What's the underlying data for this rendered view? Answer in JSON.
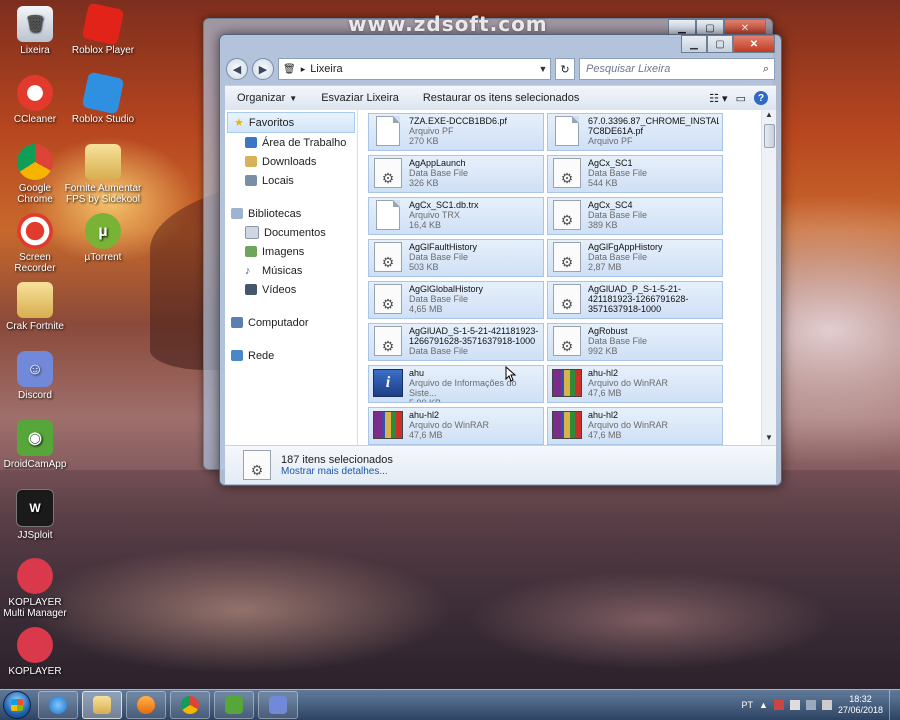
{
  "watermark": "www.zdsoft.com",
  "desktop_icons": [
    {
      "label": "Lixeira"
    },
    {
      "label": "Roblox Player"
    },
    {
      "label": "CCleaner"
    },
    {
      "label": "Roblox Studio"
    },
    {
      "label": "Google Chrome"
    },
    {
      "label": "Fornite Aumentar FPS by Sidekool"
    },
    {
      "label": "Screen Recorder"
    },
    {
      "label": "µTorrent"
    },
    {
      "label": "Crak Fortnite"
    },
    {
      "label": "Discord"
    },
    {
      "label": "DroidCamApp"
    },
    {
      "label": "JJSploit"
    },
    {
      "label": "KOPLAYER Multi Manager"
    },
    {
      "label": "KOPLAYER"
    }
  ],
  "window": {
    "minimize": "▁",
    "maximize": "▢",
    "close": "✕",
    "address": {
      "path": "Lixeira"
    },
    "search": {
      "placeholder": "Pesquisar Lixeira"
    },
    "toolbar": {
      "organize": "Organizar",
      "empty": "Esvaziar Lixeira",
      "restore": "Restaurar os itens selecionados"
    },
    "sidebar": {
      "favorites": "Favoritos",
      "desktop": "Área de Trabalho",
      "downloads": "Downloads",
      "places": "Locais",
      "libraries": "Bibliotecas",
      "documents": "Documentos",
      "images": "Imagens",
      "music": "Músicas",
      "videos": "Vídeos",
      "computer": "Computador",
      "network": "Rede"
    },
    "files": [
      {
        "name": "7ZA.EXE-DCCB1BD6.pf",
        "type": "Arquivo PF",
        "size": "270 KB",
        "icon": "doc"
      },
      {
        "name": "67.0.3396.87_CHROME_INSTALLER-7C8DE61A.pf",
        "type": "Arquivo PF",
        "size": "",
        "icon": "doc"
      },
      {
        "name": "AgAppLaunch",
        "type": "Data Base File",
        "size": "326 KB",
        "icon": "gear"
      },
      {
        "name": "AgCx_SC1",
        "type": "Data Base File",
        "size": "544 KB",
        "icon": "gear"
      },
      {
        "name": "AgCx_SC1.db.trx",
        "type": "Arquivo TRX",
        "size": "16,4 KB",
        "icon": "doc"
      },
      {
        "name": "AgCx_SC4",
        "type": "Data Base File",
        "size": "389 KB",
        "icon": "gear"
      },
      {
        "name": "AgGlFaultHistory",
        "type": "Data Base File",
        "size": "503 KB",
        "icon": "gear"
      },
      {
        "name": "AgGlFgAppHistory",
        "type": "Data Base File",
        "size": "2,87 MB",
        "icon": "gear"
      },
      {
        "name": "AgGlGlobalHistory",
        "type": "Data Base File",
        "size": "4,65 MB",
        "icon": "gear"
      },
      {
        "name": "AgGlUAD_P_S-1-5-21-421181923-1266791628-3571637918-1000",
        "type": "",
        "size": "",
        "icon": "gear"
      },
      {
        "name": "AgGlUAD_S-1-5-21-421181923-1266791628-3571637918-1000",
        "type": "Data Base File",
        "size": "",
        "icon": "gear"
      },
      {
        "name": "AgRobust",
        "type": "Data Base File",
        "size": "992 KB",
        "icon": "gear"
      },
      {
        "name": "ahu",
        "type": "Arquivo de Informações do Siste...",
        "size": "5,90 KB",
        "icon": "info"
      },
      {
        "name": "ahu-hl2",
        "type": "Arquivo do WinRAR",
        "size": "47,6 MB",
        "icon": "rar"
      },
      {
        "name": "ahu-hl2",
        "type": "Arquivo do WinRAR",
        "size": "47,6 MB",
        "icon": "rar"
      },
      {
        "name": "ahu-hl2",
        "type": "Arquivo do WinRAR",
        "size": "47,6 MB",
        "icon": "rar"
      },
      {
        "name": "ahu-hl2",
        "type": "Arquivo do WinRAR",
        "size": "",
        "icon": "rar"
      },
      {
        "name": "ahu-hl2",
        "type": "Arquivo do WinRAR",
        "size": "",
        "icon": "rar"
      }
    ],
    "details": {
      "count": "187 itens selecionados",
      "more": "Mostrar mais detalhes..."
    }
  },
  "taskbar": {
    "lang": "PT",
    "time": "18:32",
    "date": "27/06/2018"
  }
}
